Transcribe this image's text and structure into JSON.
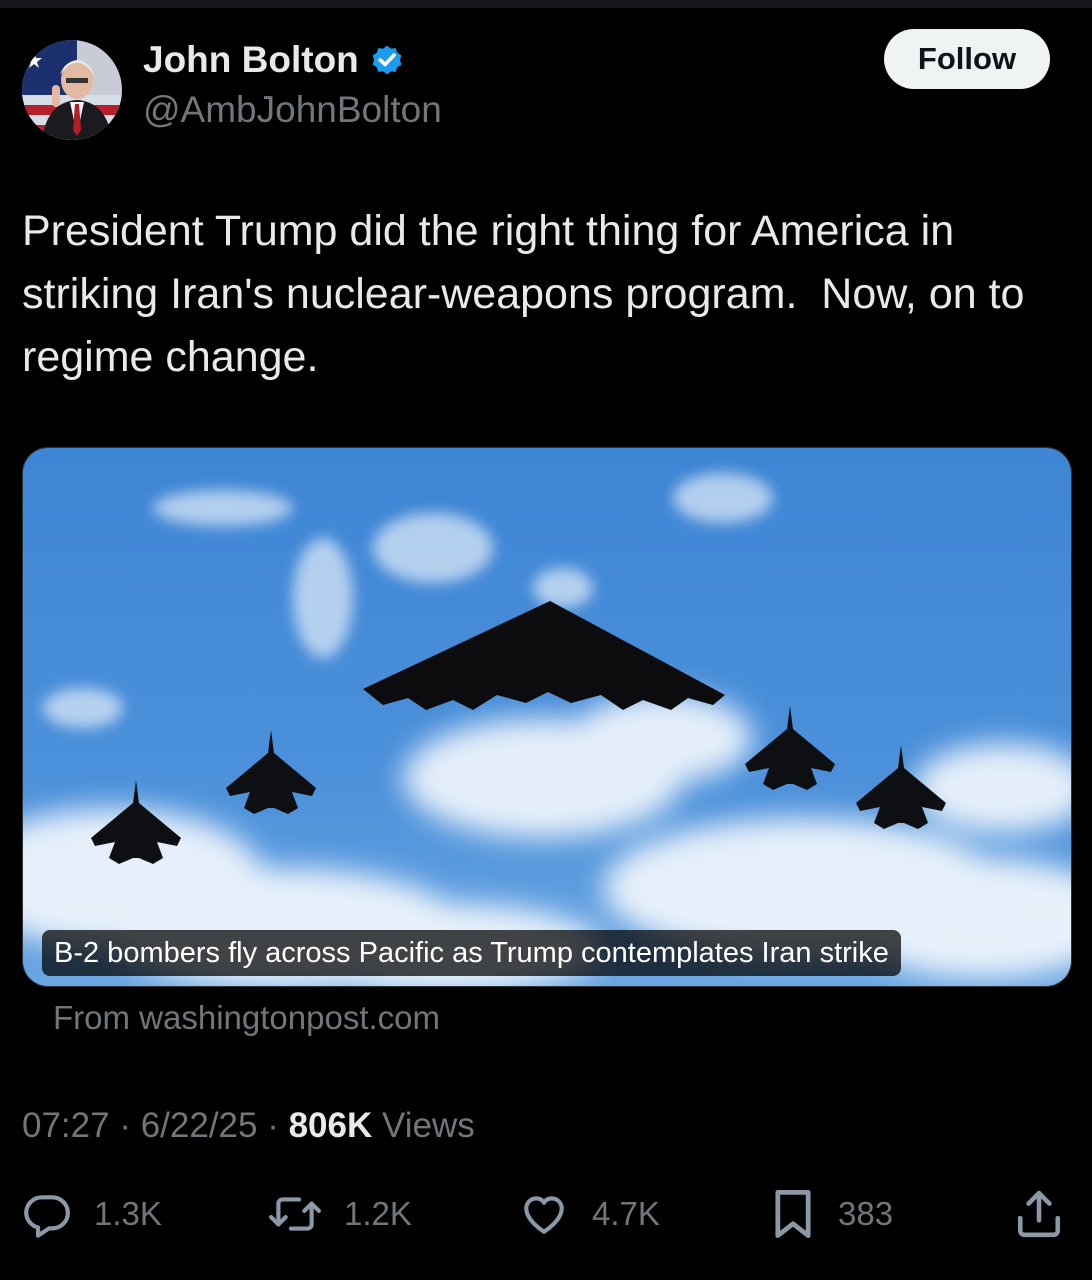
{
  "author": {
    "name": "John Bolton",
    "handle": "@AmbJohnBolton",
    "verified_icon": "verified-badge-icon"
  },
  "follow_label": "Follow",
  "tweet_text": "President Trump did the right thing for America in striking Iran's nuclear-weapons program.  Now, on to regime change.",
  "card": {
    "caption": "B-2 bombers fly across Pacific as Trump contemplates Iran strike",
    "source": "From washingtonpost.com"
  },
  "meta": {
    "time": "07:27",
    "sep1": " · ",
    "date": "6/22/25",
    "sep2": " · ",
    "views_count": "806K",
    "views_label": " Views"
  },
  "actions": {
    "replies": {
      "icon": "reply-icon",
      "count": "1.3K"
    },
    "reposts": {
      "icon": "repost-icon",
      "count": "1.2K"
    },
    "likes": {
      "icon": "heart-icon",
      "count": "4.7K"
    },
    "bookmarks": {
      "icon": "bookmark-icon",
      "count": "383"
    },
    "share": {
      "icon": "share-icon"
    }
  },
  "colors": {
    "background": "#000000",
    "text": "#e7e9ea",
    "secondary": "#71767b",
    "verified": "#1d9bf0",
    "sky": "#3f86d3"
  }
}
